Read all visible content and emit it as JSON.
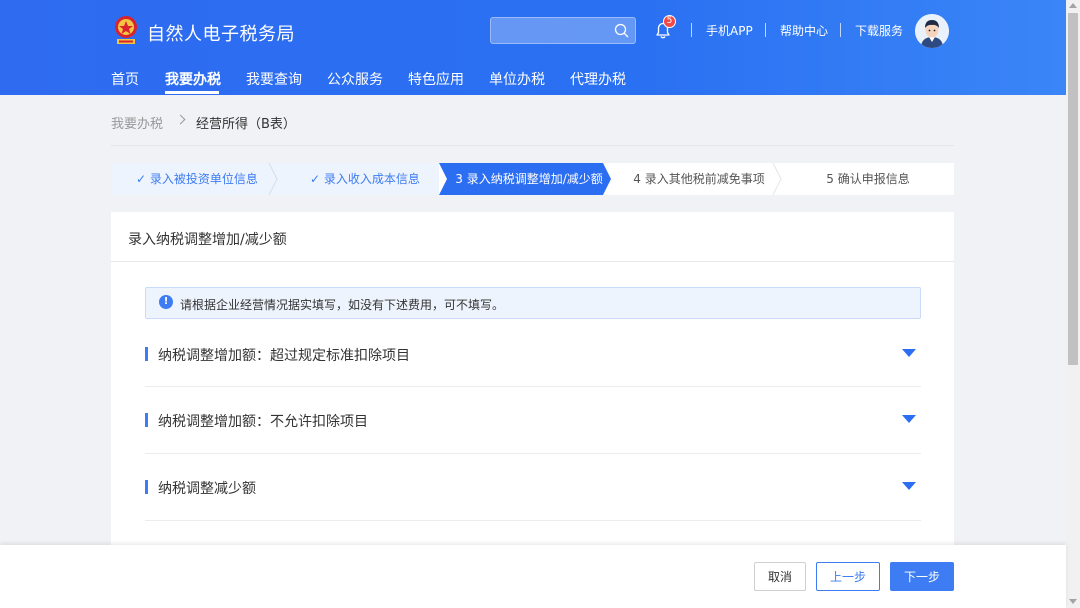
{
  "header": {
    "brand": "自然人电子税务局",
    "search_placeholder": "",
    "notification_count": "5",
    "links": [
      "手机APP",
      "帮助中心",
      "下载服务"
    ]
  },
  "nav": {
    "items": [
      "首页",
      "我要办税",
      "我要查询",
      "公众服务",
      "特色应用",
      "单位办税",
      "代理办税"
    ],
    "active": "我要办税"
  },
  "breadcrumb": {
    "parent": "我要办税",
    "current": "经营所得（B表）"
  },
  "steps": [
    {
      "label": "录入被投资单位信息",
      "state": "done"
    },
    {
      "label": "录入收入成本信息",
      "state": "done"
    },
    {
      "label": "3 录入纳税调整增加/减少额",
      "state": "active"
    },
    {
      "label": "4 录入其他税前减免事项",
      "state": "todo"
    },
    {
      "label": "5 确认申报信息",
      "state": "todo"
    }
  ],
  "panel": {
    "title": "录入纳税调整增加/减少额",
    "notice": "请根据企业经营情况据实填写，如没有下述费用，可不填写。",
    "sections": [
      "纳税调整增加额：超过规定标准扣除项目",
      "纳税调整增加额：不允许扣除项目",
      "纳税调整减少额"
    ]
  },
  "footer": {
    "cancel": "取消",
    "prev": "上一步",
    "next": "下一步"
  },
  "colors": {
    "primary": "#2c6ef2",
    "accent": "#3d7cf2",
    "badge": "#f24848"
  }
}
